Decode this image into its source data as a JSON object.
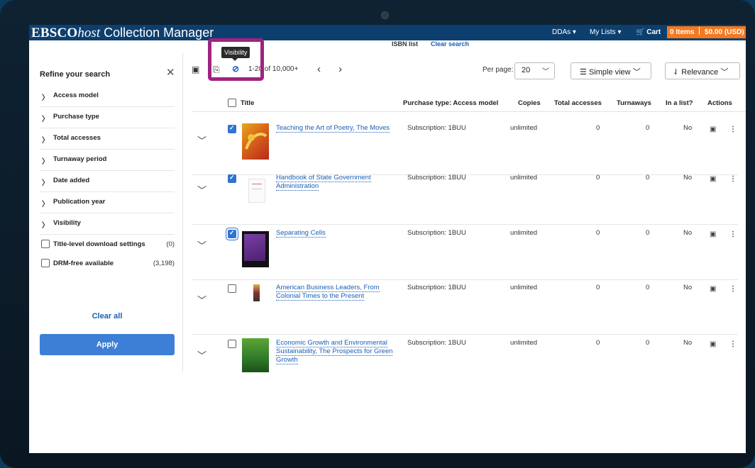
{
  "app": {
    "brand_ebsco": "EBSCO",
    "brand_host": "host",
    "brand_cm": " Collection Manager"
  },
  "topnav": {
    "ddas": "DDAs ▾",
    "mylists": "My Lists ▾",
    "cart": "Cart",
    "cart_items": "0 Items",
    "cart_total": "$0.00 (USD)"
  },
  "search": {
    "isbn_list": "ISBN list",
    "clear_search": "Clear search"
  },
  "sidebar": {
    "title": "Refine your search",
    "facets": [
      "Access model",
      "Purchase type",
      "Total accesses",
      "Turnaway period",
      "Date added",
      "Publication year",
      "Visibility"
    ],
    "checks": [
      {
        "label": "Title-level download settings",
        "count": "(0)"
      },
      {
        "label": "DRM-free available",
        "count": "(3,198)"
      }
    ],
    "clear_all": "Clear all",
    "apply": "Apply"
  },
  "toolbar": {
    "range": "1-20 of 10,000+",
    "per_page_label": "Per page:",
    "per_page_value": "20",
    "view": "Simple view",
    "sort": "Relevance",
    "tooltip": "Visibility"
  },
  "columns": {
    "title": "Title",
    "purchase": "Purchase type: Access model",
    "copies": "Copies",
    "accesses": "Total accesses",
    "turnaways": "Turnaways",
    "inlist": "In a list?",
    "actions": "Actions"
  },
  "rows": [
    {
      "title": "Teaching the Art of Poetry, The Moves",
      "purchase": "Subscription: 1BUU",
      "copies": "unlimited",
      "accesses": "0",
      "turnaways": "0",
      "inlist": "No",
      "checked": true
    },
    {
      "title": "Handbook of State Government Administration",
      "purchase": "Subscription: 1BUU",
      "copies": "unlimited",
      "accesses": "0",
      "turnaways": "0",
      "inlist": "No",
      "checked": true
    },
    {
      "title": "Separating Cells",
      "purchase": "Subscription: 1BUU",
      "copies": "unlimited",
      "accesses": "0",
      "turnaways": "0",
      "inlist": "No",
      "checked": true
    },
    {
      "title": "American Business Leaders, From Colonial Times to the Present",
      "purchase": "Subscription: 1BUU",
      "copies": "unlimited",
      "accesses": "0",
      "turnaways": "0",
      "inlist": "No",
      "checked": false
    },
    {
      "title": "Economic Growth and Environmental Sustainability, The Prospects for Green Growth",
      "purchase": "Subscription: 1BUU",
      "copies": "unlimited",
      "accesses": "0",
      "turnaways": "0",
      "inlist": "No",
      "checked": false
    }
  ],
  "colors": {
    "topbar": "#0d3f6e",
    "accent": "#f47920",
    "link": "#1a5fb4",
    "apply": "#3d7fd6",
    "highlight": "#a0237f"
  }
}
